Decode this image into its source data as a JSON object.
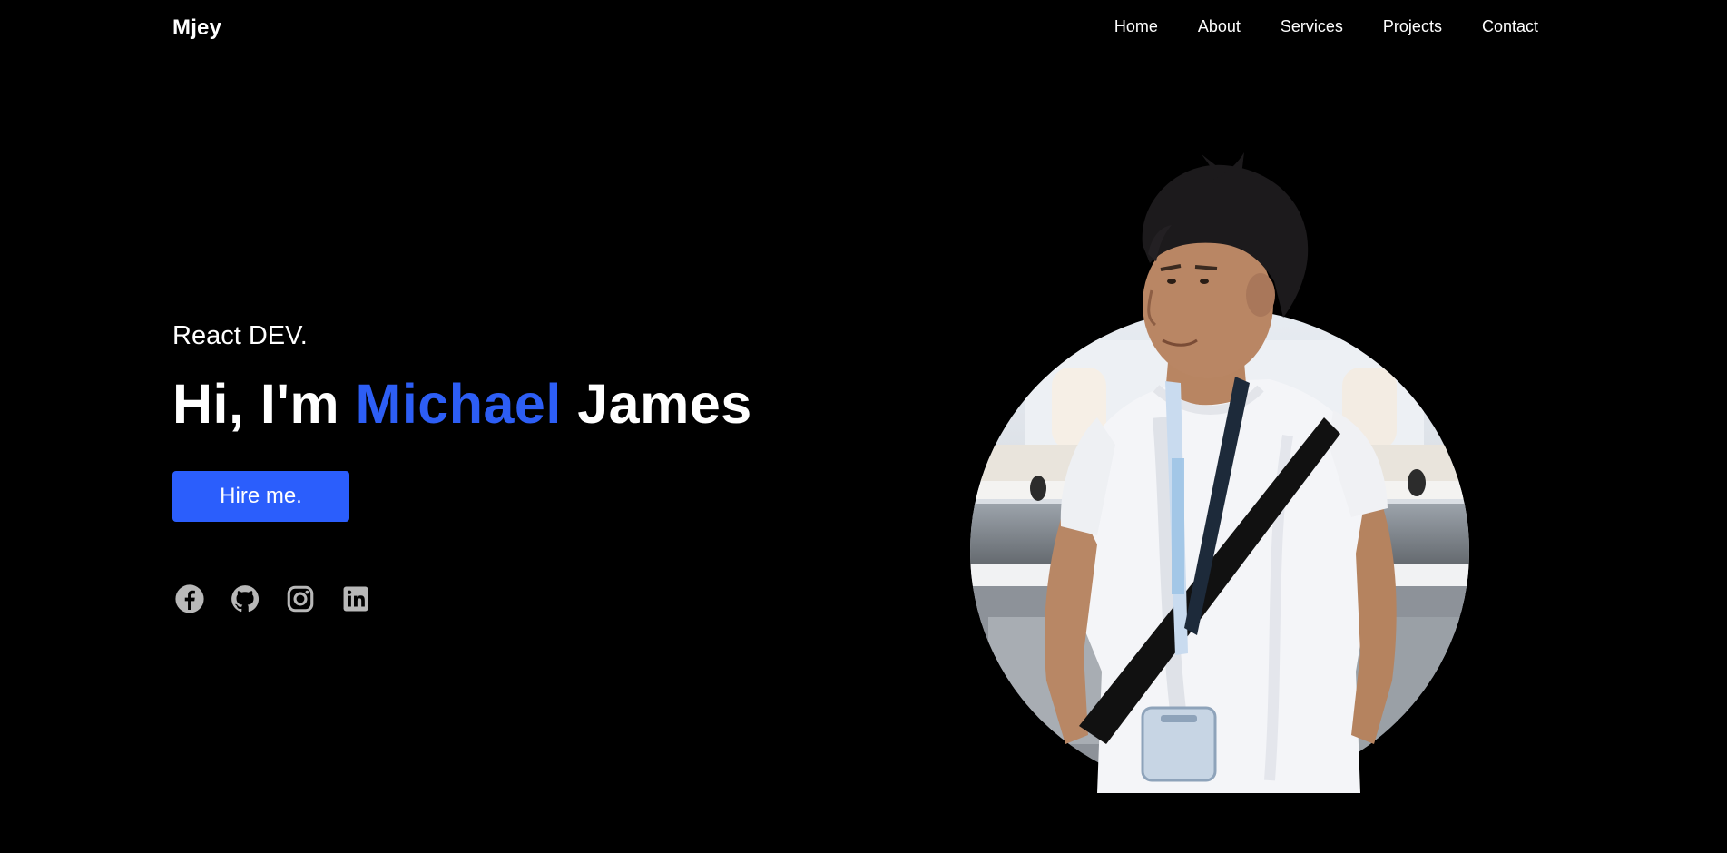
{
  "nav": {
    "brand": "Mjey",
    "links": [
      {
        "label": "Home"
      },
      {
        "label": "About"
      },
      {
        "label": "Services"
      },
      {
        "label": "Projects"
      },
      {
        "label": "Contact"
      }
    ]
  },
  "hero": {
    "subtitle": "React DEV.",
    "greeting": "Hi, I'm",
    "first_name": "Michael",
    "last_name": "James",
    "cta_label": "Hire me."
  },
  "socials": [
    {
      "icon": "facebook-icon"
    },
    {
      "icon": "github-icon"
    },
    {
      "icon": "instagram-icon"
    },
    {
      "icon": "linkedin-icon"
    }
  ],
  "colors": {
    "background": "#000000",
    "accent": "#2b5efc",
    "text": "#ffffff",
    "icon": "#bdbdbd"
  }
}
